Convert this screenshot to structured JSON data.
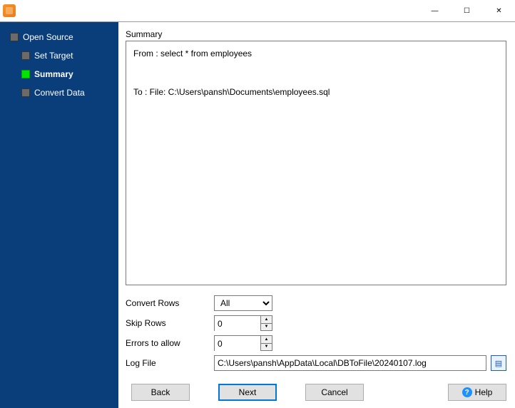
{
  "titlebar": {
    "min_glyph": "—",
    "max_glyph": "☐",
    "close_glyph": "✕"
  },
  "sidebar": {
    "root_label": "Open Source",
    "items": [
      {
        "label": "Set Target",
        "active": false
      },
      {
        "label": "Summary",
        "active": true
      },
      {
        "label": "Convert Data",
        "active": false
      }
    ]
  },
  "main": {
    "summary_heading": "Summary",
    "summary_text": "From : select * from employees\n\n\nTo : File: C:\\Users\\pansh\\Documents\\employees.sql",
    "labels": {
      "convert_rows": "Convert Rows",
      "skip_rows": "Skip Rows",
      "errors_to_allow": "Errors to allow",
      "log_file": "Log File"
    },
    "values": {
      "convert_rows": "All",
      "skip_rows": "0",
      "errors_to_allow": "0",
      "log_file": "C:\\Users\\pansh\\AppData\\Local\\DBToFile\\20240107.log"
    }
  },
  "buttons": {
    "back": "Back",
    "next": "Next",
    "cancel": "Cancel",
    "help": "Help"
  }
}
